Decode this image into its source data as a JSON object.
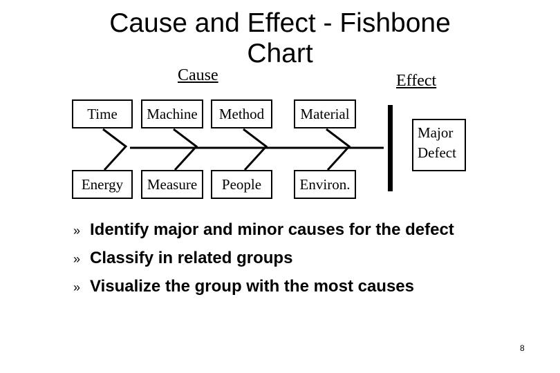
{
  "title": "Cause and Effect  - Fishbone Chart",
  "title_lines": [
    "Cause and Effect  - Fishbone",
    "Chart"
  ],
  "labels": {
    "cause": "Cause",
    "effect": "Effect"
  },
  "causes_top": [
    "Time",
    "Machine",
    "Method",
    "Material"
  ],
  "causes_bottom": [
    "Energy",
    "Measure",
    "People",
    "Environ."
  ],
  "effect_box": [
    "Major",
    "Defect"
  ],
  "bullets": [
    {
      "marker": "»",
      "text": "Identify major and minor causes for the defect"
    },
    {
      "marker": "»",
      "text": "Classify in related groups"
    },
    {
      "marker": "»",
      "text": "Visualize the group with the most causes"
    }
  ],
  "page_number": "8"
}
